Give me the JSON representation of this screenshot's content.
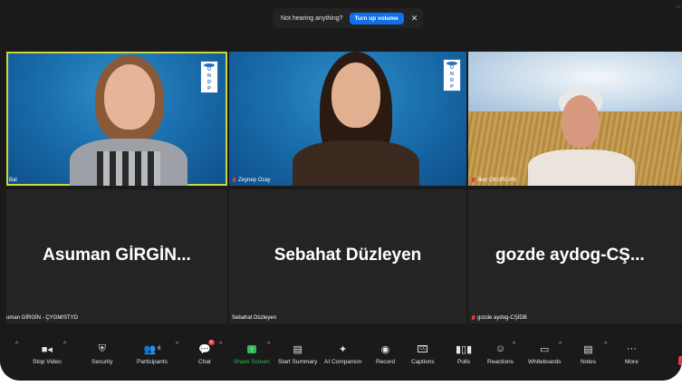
{
  "notice": {
    "text": "Not hearing anything?",
    "button": "Turn up volume",
    "close": "✕"
  },
  "tiles": [
    {
      "label": "Bal",
      "mic_muted": false
    },
    {
      "label": "Zeynep Ozay",
      "mic_muted": true,
      "logo": [
        "U",
        "N",
        "D",
        "P"
      ]
    },
    {
      "label": "İlker OKURCAN",
      "mic_muted": true
    },
    {
      "label": "uman GİRGİN - ÇYGM/STYD",
      "display_name": "Asuman  GİRGİN...",
      "mic_muted": false
    },
    {
      "label": "Sebahat Düzleyen",
      "display_name": "Sebahat Düzleyen",
      "mic_muted": false
    },
    {
      "label": "gozde aydog-CŞİDB",
      "display_name": "gozde  aydog-CŞ...",
      "mic_muted": true
    }
  ],
  "logo_tile1": [
    "U",
    "N",
    "D",
    "P"
  ],
  "toolbar": {
    "stop_video": "Stop Video",
    "security": "Security",
    "participants": "Participants",
    "participants_count": "6",
    "chat": "Chat",
    "chat_badge": "6",
    "share_screen": "Share Screen",
    "start_summary": "Start Summary",
    "ai_companion": "AI Companion",
    "record": "Record",
    "captions": "Captions",
    "polls": "Polls",
    "reactions": "Reactions",
    "whiteboards": "Whiteboards",
    "notes": "Notes",
    "more": "More"
  },
  "colors": {
    "active_border": "#c9d83a",
    "share_green": "#2ebd59",
    "muted_red": "#e23b3b",
    "button_blue": "#0e71eb"
  }
}
